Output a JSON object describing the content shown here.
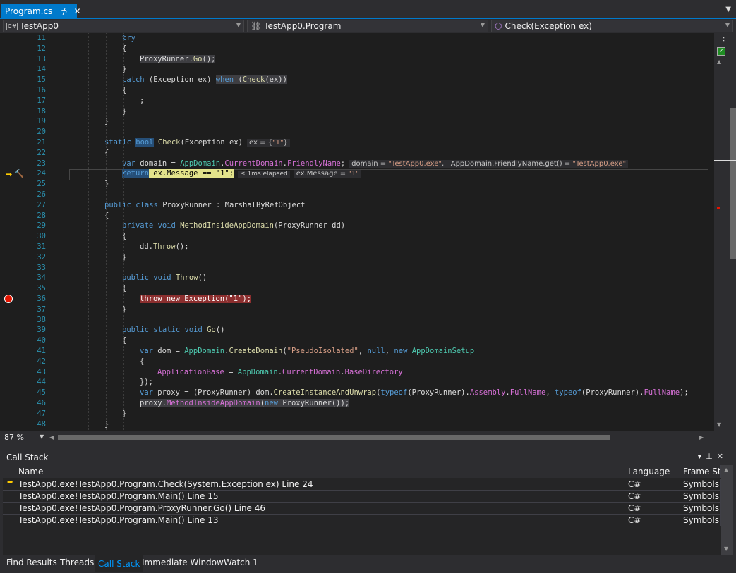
{
  "tabs": [
    {
      "label": "Program.cs",
      "pin": "⊅",
      "close": "✕"
    }
  ],
  "navbar": {
    "project": "TestApp0",
    "class_name": "TestApp0.Program",
    "member": "Check(Exception ex)",
    "cs_badge": "C#"
  },
  "editor": {
    "lines": [
      {
        "n": "11",
        "html": "<span class=\"kw\">try</span>",
        "indent": 3
      },
      {
        "n": "12",
        "html": "{",
        "indent": 3
      },
      {
        "n": "13",
        "html": "<span class=\"hlgray\">ProxyRunner.<span class=\"me\">Go</span>();</span>",
        "indent": 4
      },
      {
        "n": "14",
        "html": "}",
        "indent": 3
      },
      {
        "n": "15",
        "html": "<span class=\"kw\">catch</span> (Exception ex) <span class=\"hlgray\"><span class=\"kw\">when</span> (<span class=\"me\">Check</span>(ex))</span>",
        "indent": 3
      },
      {
        "n": "16",
        "html": "{",
        "indent": 3
      },
      {
        "n": "17",
        "html": ";",
        "indent": 4
      },
      {
        "n": "18",
        "html": "}",
        "indent": 3
      },
      {
        "n": "19",
        "html": "}",
        "indent": 2
      },
      {
        "n": "20",
        "html": "",
        "indent": 2
      },
      {
        "n": "21",
        "html": "<span class=\"kw\">static</span> <span class=\"kw hlblue\">bool</span> <span class=\"me\">Check</span>(Exception ex)<span class=\"inl\">ex = {<span class=\"q\">\"1\"</span>}</span>",
        "indent": 2
      },
      {
        "n": "22",
        "html": "{",
        "indent": 2
      },
      {
        "n": "23",
        "html": "<span class=\"kw\">var</span> domain = <span class=\"ty\">AppDomain</span>.<span class=\"pr\">CurrentDomain</span>.<span class=\"pr\">FriendlyName</span>;<span class=\"inl\">domain = <span class=\"q\">\"TestApp0.exe\"</span>,&nbsp;&nbsp;&nbsp;AppDomain.FriendlyName.get() = <span class=\"q\">\"TestApp0.exe\"</span></span>",
        "indent": 3
      },
      {
        "n": "24",
        "html": "<span class=\"hlyellow\"><span style=\"background:#264f78;color:#569cd6\">return</span> ex.Message == \"1\";</span><span class=\"inl\" style=\"font-size:9px\">≤ 1ms elapsed</span><span class=\"inl\">ex.Message = <span class=\"q\">\"1\"</span></span>",
        "indent": 3
      },
      {
        "n": "25",
        "html": "}",
        "indent": 2
      },
      {
        "n": "26",
        "html": "",
        "indent": 2
      },
      {
        "n": "27",
        "html": "<span class=\"kw\">public</span> <span class=\"kw\">class</span> ProxyRunner : MarshalByRefObject",
        "indent": 2
      },
      {
        "n": "28",
        "html": "{",
        "indent": 2
      },
      {
        "n": "29",
        "html": "<span class=\"kw\">private</span> <span class=\"kw\">void</span> <span class=\"me\">MethodInsideAppDomain</span>(ProxyRunner dd)",
        "indent": 3
      },
      {
        "n": "30",
        "html": "{",
        "indent": 3
      },
      {
        "n": "31",
        "html": "dd.<span class=\"me\">Throw</span>();",
        "indent": 4
      },
      {
        "n": "32",
        "html": "}",
        "indent": 3
      },
      {
        "n": "33",
        "html": "",
        "indent": 3
      },
      {
        "n": "34",
        "html": "<span class=\"kw\">public</span> <span class=\"kw\">void</span> <span class=\"me\">Throw</span>()",
        "indent": 3
      },
      {
        "n": "35",
        "html": "{",
        "indent": 3
      },
      {
        "n": "36",
        "html": "<span class=\"hlred\">throw new Exception(\"1\");</span>",
        "indent": 4
      },
      {
        "n": "37",
        "html": "}",
        "indent": 3
      },
      {
        "n": "38",
        "html": "",
        "indent": 3
      },
      {
        "n": "39",
        "html": "<span class=\"kw\">public</span> <span class=\"kw\">static</span> <span class=\"kw\">void</span> <span class=\"me\">Go</span>()",
        "indent": 3
      },
      {
        "n": "40",
        "html": "{",
        "indent": 3
      },
      {
        "n": "41",
        "html": "<span class=\"kw\">var</span> dom = <span class=\"ty\">AppDomain</span>.<span class=\"me\">CreateDomain</span>(<span class=\"st\">\"PseudoIsolated\"</span>, <span class=\"kw\">null</span>, <span class=\"kw\">new</span> <span class=\"ty\">AppDomainSetup</span>",
        "indent": 4
      },
      {
        "n": "42",
        "html": "{",
        "indent": 4
      },
      {
        "n": "43",
        "html": "<span class=\"pr\">ApplicationBase</span> = <span class=\"ty\">AppDomain</span>.<span class=\"pr\">CurrentDomain</span>.<span class=\"pr\">BaseDirectory</span>",
        "indent": 5
      },
      {
        "n": "44",
        "html": "});",
        "indent": 4
      },
      {
        "n": "45",
        "html": "<span class=\"kw\">var</span> proxy = (ProxyRunner) dom.<span class=\"me\">CreateInstanceAndUnwrap</span>(<span class=\"kw\">typeof</span>(ProxyRunner).<span class=\"pr\">Assembly</span>.<span class=\"pr\">FullName</span>, <span class=\"kw\">typeof</span>(ProxyRunner).<span class=\"pr\">FullName</span>);",
        "indent": 4
      },
      {
        "n": "46",
        "html": "<span class=\"hlgray\">proxy.<span class=\"pr\">MethodInsideAppDomain</span>(<span class=\"kw\">new</span> ProxyRunner());</span>",
        "indent": 4
      },
      {
        "n": "47",
        "html": "}",
        "indent": 3
      },
      {
        "n": "48",
        "html": "}",
        "indent": 2
      }
    ]
  },
  "zoom": "87 %",
  "callstack": {
    "title": "Call Stack",
    "columns": [
      "Name",
      "Language",
      "Frame Stat"
    ],
    "rows": [
      {
        "name": "TestApp0.exe!TestApp0.Program.Check(System.Exception ex) Line 24",
        "lang": "C#",
        "frame": "Symbols lo",
        "current": true
      },
      {
        "name": "TestApp0.exe!TestApp0.Program.Main() Line 15",
        "lang": "C#",
        "frame": "Symbols lo",
        "current": false
      },
      {
        "name": "TestApp0.exe!TestApp0.Program.ProxyRunner.Go() Line 46",
        "lang": "C#",
        "frame": "Symbols lo",
        "current": false
      },
      {
        "name": "TestApp0.exe!TestApp0.Program.Main() Line 13",
        "lang": "C#",
        "frame": "Symbols lo",
        "current": false
      }
    ]
  },
  "bottom_tabs": [
    "Find Results",
    "Threads",
    "Call Stack",
    "Immediate Window",
    "Watch 1"
  ],
  "active_bottom_tab": "Call Stack",
  "colors": {
    "accent": "#007acc",
    "keyword": "#569cd6",
    "type": "#4ec9b0",
    "method": "#dcdcaa",
    "string": "#d69d85",
    "property": "#d670d6",
    "breakpoint": "#e51400",
    "current_statement": "#e3e38b"
  }
}
